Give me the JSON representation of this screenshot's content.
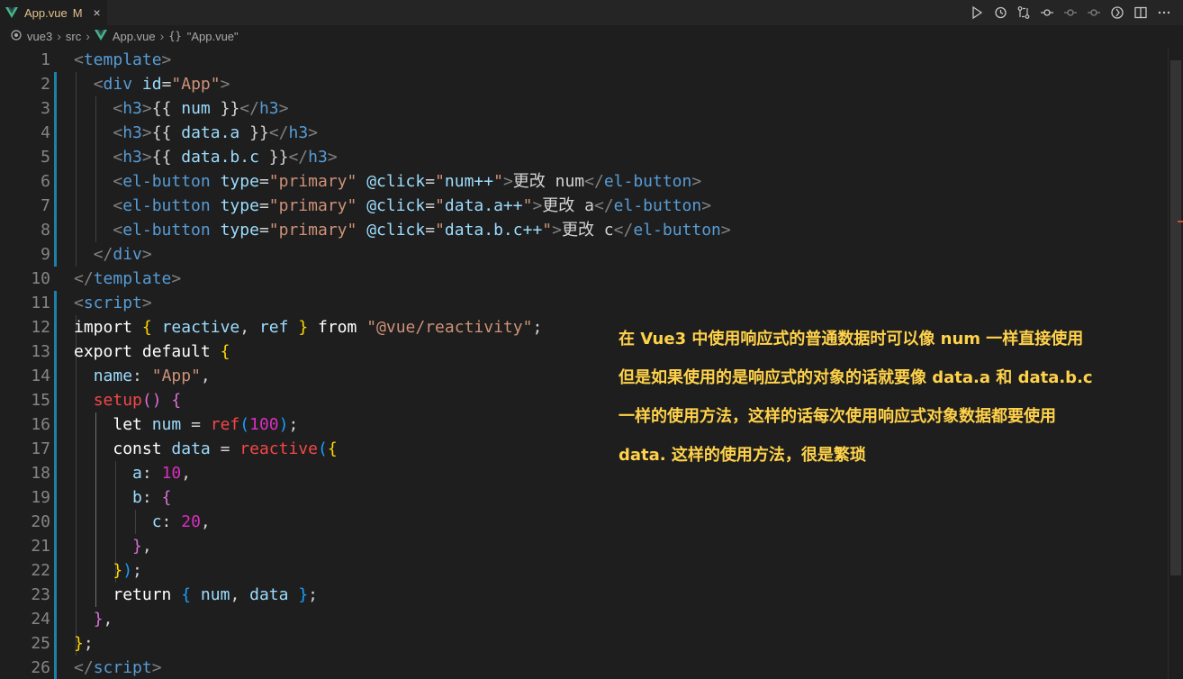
{
  "tab": {
    "label": "App.vue",
    "modified": "M",
    "close": "×"
  },
  "breadcrumb": [
    "vue3",
    "src",
    "App.vue",
    "\"App.vue\""
  ],
  "breadcrumb_icons": [
    "folder-dot-icon",
    "vue-file-icon",
    "object-braces-icon"
  ],
  "code_lines": [
    [
      {
        "t": "<",
        "c": "bracket"
      },
      {
        "t": "template",
        "c": "tag"
      },
      {
        "t": ">",
        "c": "bracket"
      }
    ],
    [
      {
        "t": "  "
      },
      {
        "t": "<",
        "c": "bracket"
      },
      {
        "t": "div",
        "c": "tag"
      },
      {
        "t": " "
      },
      {
        "t": "id",
        "c": "attr"
      },
      {
        "t": "=",
        "c": "plain"
      },
      {
        "t": "\"App\"",
        "c": "str"
      },
      {
        "t": ">",
        "c": "bracket"
      }
    ],
    [
      {
        "t": "    "
      },
      {
        "t": "<",
        "c": "bracket"
      },
      {
        "t": "h3",
        "c": "tag"
      },
      {
        "t": ">",
        "c": "bracket"
      },
      {
        "t": "{{ ",
        "c": "plain"
      },
      {
        "t": "num",
        "c": "var"
      },
      {
        "t": " }}",
        "c": "plain"
      },
      {
        "t": "</",
        "c": "bracket"
      },
      {
        "t": "h3",
        "c": "tag"
      },
      {
        "t": ">",
        "c": "bracket"
      }
    ],
    [
      {
        "t": "    "
      },
      {
        "t": "<",
        "c": "bracket"
      },
      {
        "t": "h3",
        "c": "tag"
      },
      {
        "t": ">",
        "c": "bracket"
      },
      {
        "t": "{{ ",
        "c": "plain"
      },
      {
        "t": "data.a",
        "c": "var"
      },
      {
        "t": " }}",
        "c": "plain"
      },
      {
        "t": "</",
        "c": "bracket"
      },
      {
        "t": "h3",
        "c": "tag"
      },
      {
        "t": ">",
        "c": "bracket"
      }
    ],
    [
      {
        "t": "    "
      },
      {
        "t": "<",
        "c": "bracket"
      },
      {
        "t": "h3",
        "c": "tag"
      },
      {
        "t": ">",
        "c": "bracket"
      },
      {
        "t": "{{ ",
        "c": "plain"
      },
      {
        "t": "data.b.c",
        "c": "var"
      },
      {
        "t": " }}",
        "c": "plain"
      },
      {
        "t": "</",
        "c": "bracket"
      },
      {
        "t": "h3",
        "c": "tag"
      },
      {
        "t": ">",
        "c": "bracket"
      }
    ],
    [
      {
        "t": "    "
      },
      {
        "t": "<",
        "c": "bracket"
      },
      {
        "t": "el-button",
        "c": "tag"
      },
      {
        "t": " "
      },
      {
        "t": "type",
        "c": "attr"
      },
      {
        "t": "=",
        "c": "plain"
      },
      {
        "t": "\"primary\"",
        "c": "str"
      },
      {
        "t": " "
      },
      {
        "t": "@click",
        "c": "attr"
      },
      {
        "t": "=",
        "c": "plain"
      },
      {
        "t": "\"",
        "c": "str"
      },
      {
        "t": "num++",
        "c": "var"
      },
      {
        "t": "\"",
        "c": "str"
      },
      {
        "t": ">",
        "c": "bracket"
      },
      {
        "t": "更改",
        "c": "cjk"
      },
      {
        "t": " num",
        "c": "plain"
      },
      {
        "t": "</",
        "c": "bracket"
      },
      {
        "t": "el-button",
        "c": "tag"
      },
      {
        "t": ">",
        "c": "bracket"
      }
    ],
    [
      {
        "t": "    "
      },
      {
        "t": "<",
        "c": "bracket"
      },
      {
        "t": "el-button",
        "c": "tag"
      },
      {
        "t": " "
      },
      {
        "t": "type",
        "c": "attr"
      },
      {
        "t": "=",
        "c": "plain"
      },
      {
        "t": "\"primary\"",
        "c": "str"
      },
      {
        "t": " "
      },
      {
        "t": "@click",
        "c": "attr"
      },
      {
        "t": "=",
        "c": "plain"
      },
      {
        "t": "\"",
        "c": "str"
      },
      {
        "t": "data.a++",
        "c": "var"
      },
      {
        "t": "\"",
        "c": "str"
      },
      {
        "t": ">",
        "c": "bracket"
      },
      {
        "t": "更改",
        "c": "cjk"
      },
      {
        "t": " a",
        "c": "plain"
      },
      {
        "t": "</",
        "c": "bracket"
      },
      {
        "t": "el-button",
        "c": "tag"
      },
      {
        "t": ">",
        "c": "bracket"
      }
    ],
    [
      {
        "t": "    "
      },
      {
        "t": "<",
        "c": "bracket"
      },
      {
        "t": "el-button",
        "c": "tag"
      },
      {
        "t": " "
      },
      {
        "t": "type",
        "c": "attr"
      },
      {
        "t": "=",
        "c": "plain"
      },
      {
        "t": "\"primary\"",
        "c": "str"
      },
      {
        "t": " "
      },
      {
        "t": "@click",
        "c": "attr"
      },
      {
        "t": "=",
        "c": "plain"
      },
      {
        "t": "\"",
        "c": "str"
      },
      {
        "t": "data.b.c++",
        "c": "var"
      },
      {
        "t": "\"",
        "c": "str"
      },
      {
        "t": ">",
        "c": "bracket"
      },
      {
        "t": "更改",
        "c": "cjk"
      },
      {
        "t": " c",
        "c": "plain"
      },
      {
        "t": "</",
        "c": "bracket"
      },
      {
        "t": "el-button",
        "c": "tag"
      },
      {
        "t": ">",
        "c": "bracket"
      }
    ],
    [
      {
        "t": "  "
      },
      {
        "t": "</",
        "c": "bracket"
      },
      {
        "t": "div",
        "c": "tag"
      },
      {
        "t": ">",
        "c": "bracket"
      }
    ],
    [
      {
        "t": "</",
        "c": "bracket"
      },
      {
        "t": "template",
        "c": "tag"
      },
      {
        "t": ">",
        "c": "bracket"
      }
    ],
    [
      {
        "t": "<",
        "c": "bracket"
      },
      {
        "t": "script",
        "c": "tag"
      },
      {
        "t": ">",
        "c": "bracket"
      }
    ],
    [
      {
        "t": "import",
        "c": "kw"
      },
      {
        "t": " "
      },
      {
        "t": "{",
        "c": "brace"
      },
      {
        "t": " "
      },
      {
        "t": "reactive",
        "c": "var"
      },
      {
        "t": ", ",
        "c": "plain"
      },
      {
        "t": "ref",
        "c": "var"
      },
      {
        "t": " "
      },
      {
        "t": "}",
        "c": "brace"
      },
      {
        "t": " "
      },
      {
        "t": "from",
        "c": "kw"
      },
      {
        "t": " "
      },
      {
        "t": "\"@vue/reactivity\"",
        "c": "str"
      },
      {
        "t": ";",
        "c": "plain"
      }
    ],
    [
      {
        "t": "export",
        "c": "kw"
      },
      {
        "t": " "
      },
      {
        "t": "default",
        "c": "kw"
      },
      {
        "t": " "
      },
      {
        "t": "{",
        "c": "brace"
      }
    ],
    [
      {
        "t": "  "
      },
      {
        "t": "name",
        "c": "var"
      },
      {
        "t": ": ",
        "c": "plain"
      },
      {
        "t": "\"App\"",
        "c": "str"
      },
      {
        "t": ",",
        "c": "plain"
      }
    ],
    [
      {
        "t": "  "
      },
      {
        "t": "setup",
        "c": "fn"
      },
      {
        "t": "()",
        "c": "brace2"
      },
      {
        "t": " "
      },
      {
        "t": "{",
        "c": "brace2"
      }
    ],
    [
      {
        "t": "    "
      },
      {
        "t": "let",
        "c": "kw"
      },
      {
        "t": " "
      },
      {
        "t": "num",
        "c": "var"
      },
      {
        "t": " = ",
        "c": "plain"
      },
      {
        "t": "ref",
        "c": "fn"
      },
      {
        "t": "(",
        "c": "brace3"
      },
      {
        "t": "100",
        "c": "num"
      },
      {
        "t": ")",
        "c": "brace3"
      },
      {
        "t": ";",
        "c": "plain"
      }
    ],
    [
      {
        "t": "    "
      },
      {
        "t": "const",
        "c": "kw"
      },
      {
        "t": " "
      },
      {
        "t": "data",
        "c": "var"
      },
      {
        "t": " = ",
        "c": "plain"
      },
      {
        "t": "reactive",
        "c": "fn"
      },
      {
        "t": "(",
        "c": "brace3"
      },
      {
        "t": "{",
        "c": "brace"
      }
    ],
    [
      {
        "t": "      "
      },
      {
        "t": "a",
        "c": "var"
      },
      {
        "t": ": ",
        "c": "plain"
      },
      {
        "t": "10",
        "c": "num"
      },
      {
        "t": ",",
        "c": "plain"
      }
    ],
    [
      {
        "t": "      "
      },
      {
        "t": "b",
        "c": "var"
      },
      {
        "t": ": ",
        "c": "plain"
      },
      {
        "t": "{",
        "c": "brace2"
      }
    ],
    [
      {
        "t": "        "
      },
      {
        "t": "c",
        "c": "var"
      },
      {
        "t": ": ",
        "c": "plain"
      },
      {
        "t": "20",
        "c": "num"
      },
      {
        "t": ",",
        "c": "plain"
      }
    ],
    [
      {
        "t": "      "
      },
      {
        "t": "}",
        "c": "brace2"
      },
      {
        "t": ",",
        "c": "plain"
      }
    ],
    [
      {
        "t": "    "
      },
      {
        "t": "}",
        "c": "brace"
      },
      {
        "t": ")",
        "c": "brace3"
      },
      {
        "t": ";",
        "c": "plain"
      }
    ],
    [
      {
        "t": "    "
      },
      {
        "t": "return",
        "c": "kw"
      },
      {
        "t": " "
      },
      {
        "t": "{",
        "c": "brace3"
      },
      {
        "t": " "
      },
      {
        "t": "num",
        "c": "var"
      },
      {
        "t": ", ",
        "c": "plain"
      },
      {
        "t": "data",
        "c": "var"
      },
      {
        "t": " "
      },
      {
        "t": "}",
        "c": "brace3"
      },
      {
        "t": ";",
        "c": "plain"
      }
    ],
    [
      {
        "t": "  "
      },
      {
        "t": "}",
        "c": "brace2"
      },
      {
        "t": ",",
        "c": "plain"
      }
    ],
    [
      {
        "t": "}",
        "c": "brace"
      },
      {
        "t": ";",
        "c": "plain"
      }
    ],
    [
      {
        "t": "</",
        "c": "bracket"
      },
      {
        "t": "script",
        "c": "tag"
      },
      {
        "t": ">",
        "c": "bracket"
      }
    ]
  ],
  "annotation": [
    "在 Vue3 中使用响应式的普通数据时可以像 num 一样直接使用",
    "但是如果使用的是响应式的对象的话就要像 data.a 和 data.b.c",
    "一样的使用方法，这样的话每次使用响应式对象数据都要使用",
    "data. 这样的使用方法，很是繁琐"
  ],
  "toolbar_icons": [
    "run-icon",
    "timeline-history-icon",
    "compare-changes-icon",
    "git-commit-icon",
    "previous-change-icon",
    "next-change-icon",
    "vue-devtools-icon",
    "split-editor-icon",
    "more-actions-icon"
  ],
  "colors": {
    "accent": "#1b81a8",
    "annotation": "#ffd24a",
    "modified": "#e2c08d"
  }
}
